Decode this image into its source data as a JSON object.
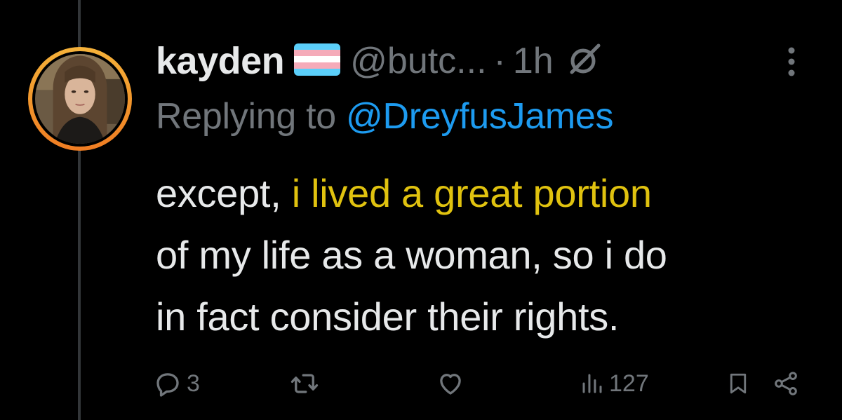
{
  "tweet": {
    "display_name": "kayden",
    "handle": "@butc...",
    "separator": "·",
    "time": "1h",
    "replying_prefix": "Replying to ",
    "replying_to": "@DreyfusJames",
    "text_lines": [
      {
        "plain": "except, ",
        "highlight": "i lived a great portion"
      },
      {
        "plain": "of my life as a woman, so i do",
        "highlight": ""
      },
      {
        "plain": "in fact consider their rights.",
        "highlight": ""
      }
    ],
    "icons": {
      "flag": "transgender-flag-emoji",
      "grok": "grok-icon",
      "more": "more-vertical-icon"
    }
  },
  "actions": {
    "reply_count": "3",
    "retweet_count": "",
    "like_count": "",
    "views_count": "127"
  },
  "colors": {
    "background": "#000000",
    "text": "#e7e9ea",
    "muted": "#71767b",
    "link": "#1d9bf0",
    "highlight": "#e0c20f",
    "avatar_ring": "#f29a2e",
    "thread_line": "#333639"
  }
}
